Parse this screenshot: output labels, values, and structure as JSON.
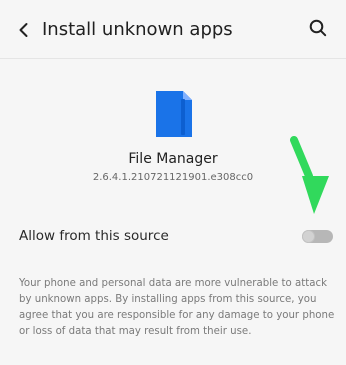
{
  "header": {
    "title": "Install unknown apps",
    "back_icon": "back-arrow-icon",
    "search_icon": "search-icon"
  },
  "app": {
    "name": "File Manager",
    "version": "2.6.4.1.210721121901.e308cc0",
    "icon": "file-manager-folder-icon",
    "icon_color": "#1a73e8"
  },
  "setting": {
    "label": "Allow from this source",
    "enabled": false
  },
  "annotation": {
    "icon": "arrow-pointer-icon",
    "color": "#31d95c"
  },
  "warning": {
    "text": "Your phone and personal data are more vulnerable to attack by unknown apps. By installing apps from this source, you agree that you are responsible for any damage to your phone or loss of data that may result from their use."
  },
  "colors": {
    "background": "#f6f6f6",
    "toggle_track": "#b7b7b7",
    "toggle_knob": "#d2d2d2"
  }
}
